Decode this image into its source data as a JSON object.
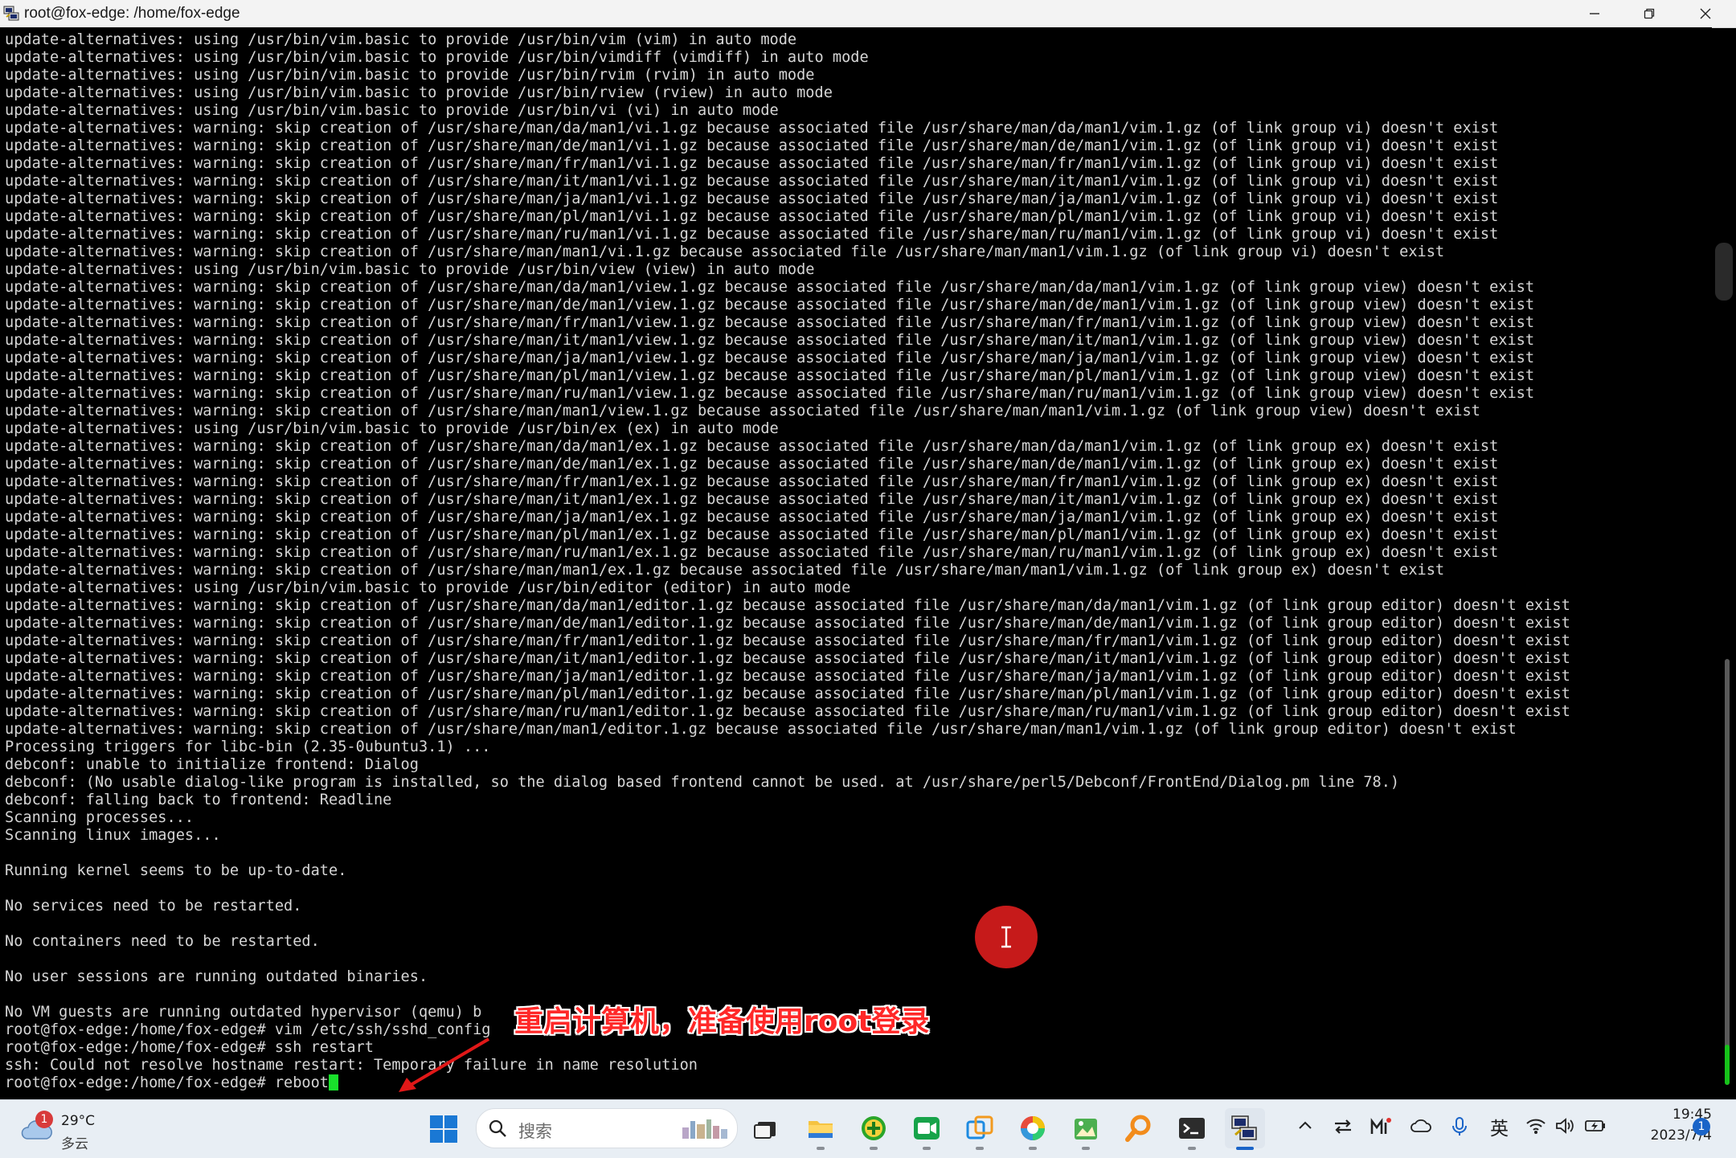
{
  "window": {
    "title": "root@fox-edge: /home/fox-edge"
  },
  "terminal": {
    "lines": [
      "update-alternatives: using /usr/bin/vim.basic to provide /usr/bin/vim (vim) in auto mode",
      "update-alternatives: using /usr/bin/vim.basic to provide /usr/bin/vimdiff (vimdiff) in auto mode",
      "update-alternatives: using /usr/bin/vim.basic to provide /usr/bin/rvim (rvim) in auto mode",
      "update-alternatives: using /usr/bin/vim.basic to provide /usr/bin/rview (rview) in auto mode",
      "update-alternatives: using /usr/bin/vim.basic to provide /usr/bin/vi (vi) in auto mode",
      "update-alternatives: warning: skip creation of /usr/share/man/da/man1/vi.1.gz because associated file /usr/share/man/da/man1/vim.1.gz (of link group vi) doesn't exist",
      "update-alternatives: warning: skip creation of /usr/share/man/de/man1/vi.1.gz because associated file /usr/share/man/de/man1/vim.1.gz (of link group vi) doesn't exist",
      "update-alternatives: warning: skip creation of /usr/share/man/fr/man1/vi.1.gz because associated file /usr/share/man/fr/man1/vim.1.gz (of link group vi) doesn't exist",
      "update-alternatives: warning: skip creation of /usr/share/man/it/man1/vi.1.gz because associated file /usr/share/man/it/man1/vim.1.gz (of link group vi) doesn't exist",
      "update-alternatives: warning: skip creation of /usr/share/man/ja/man1/vi.1.gz because associated file /usr/share/man/ja/man1/vim.1.gz (of link group vi) doesn't exist",
      "update-alternatives: warning: skip creation of /usr/share/man/pl/man1/vi.1.gz because associated file /usr/share/man/pl/man1/vim.1.gz (of link group vi) doesn't exist",
      "update-alternatives: warning: skip creation of /usr/share/man/ru/man1/vi.1.gz because associated file /usr/share/man/ru/man1/vim.1.gz (of link group vi) doesn't exist",
      "update-alternatives: warning: skip creation of /usr/share/man/man1/vi.1.gz because associated file /usr/share/man/man1/vim.1.gz (of link group vi) doesn't exist",
      "update-alternatives: using /usr/bin/vim.basic to provide /usr/bin/view (view) in auto mode",
      "update-alternatives: warning: skip creation of /usr/share/man/da/man1/view.1.gz because associated file /usr/share/man/da/man1/vim.1.gz (of link group view) doesn't exist",
      "update-alternatives: warning: skip creation of /usr/share/man/de/man1/view.1.gz because associated file /usr/share/man/de/man1/vim.1.gz (of link group view) doesn't exist",
      "update-alternatives: warning: skip creation of /usr/share/man/fr/man1/view.1.gz because associated file /usr/share/man/fr/man1/vim.1.gz (of link group view) doesn't exist",
      "update-alternatives: warning: skip creation of /usr/share/man/it/man1/view.1.gz because associated file /usr/share/man/it/man1/vim.1.gz (of link group view) doesn't exist",
      "update-alternatives: warning: skip creation of /usr/share/man/ja/man1/view.1.gz because associated file /usr/share/man/ja/man1/vim.1.gz (of link group view) doesn't exist",
      "update-alternatives: warning: skip creation of /usr/share/man/pl/man1/view.1.gz because associated file /usr/share/man/pl/man1/vim.1.gz (of link group view) doesn't exist",
      "update-alternatives: warning: skip creation of /usr/share/man/ru/man1/view.1.gz because associated file /usr/share/man/ru/man1/vim.1.gz (of link group view) doesn't exist",
      "update-alternatives: warning: skip creation of /usr/share/man/man1/view.1.gz because associated file /usr/share/man/man1/vim.1.gz (of link group view) doesn't exist",
      "update-alternatives: using /usr/bin/vim.basic to provide /usr/bin/ex (ex) in auto mode",
      "update-alternatives: warning: skip creation of /usr/share/man/da/man1/ex.1.gz because associated file /usr/share/man/da/man1/vim.1.gz (of link group ex) doesn't exist",
      "update-alternatives: warning: skip creation of /usr/share/man/de/man1/ex.1.gz because associated file /usr/share/man/de/man1/vim.1.gz (of link group ex) doesn't exist",
      "update-alternatives: warning: skip creation of /usr/share/man/fr/man1/ex.1.gz because associated file /usr/share/man/fr/man1/vim.1.gz (of link group ex) doesn't exist",
      "update-alternatives: warning: skip creation of /usr/share/man/it/man1/ex.1.gz because associated file /usr/share/man/it/man1/vim.1.gz (of link group ex) doesn't exist",
      "update-alternatives: warning: skip creation of /usr/share/man/ja/man1/ex.1.gz because associated file /usr/share/man/ja/man1/vim.1.gz (of link group ex) doesn't exist",
      "update-alternatives: warning: skip creation of /usr/share/man/pl/man1/ex.1.gz because associated file /usr/share/man/pl/man1/vim.1.gz (of link group ex) doesn't exist",
      "update-alternatives: warning: skip creation of /usr/share/man/ru/man1/ex.1.gz because associated file /usr/share/man/ru/man1/vim.1.gz (of link group ex) doesn't exist",
      "update-alternatives: warning: skip creation of /usr/share/man/man1/ex.1.gz because associated file /usr/share/man/man1/vim.1.gz (of link group ex) doesn't exist",
      "update-alternatives: using /usr/bin/vim.basic to provide /usr/bin/editor (editor) in auto mode",
      "update-alternatives: warning: skip creation of /usr/share/man/da/man1/editor.1.gz because associated file /usr/share/man/da/man1/vim.1.gz (of link group editor) doesn't exist",
      "update-alternatives: warning: skip creation of /usr/share/man/de/man1/editor.1.gz because associated file /usr/share/man/de/man1/vim.1.gz (of link group editor) doesn't exist",
      "update-alternatives: warning: skip creation of /usr/share/man/fr/man1/editor.1.gz because associated file /usr/share/man/fr/man1/vim.1.gz (of link group editor) doesn't exist",
      "update-alternatives: warning: skip creation of /usr/share/man/it/man1/editor.1.gz because associated file /usr/share/man/it/man1/vim.1.gz (of link group editor) doesn't exist",
      "update-alternatives: warning: skip creation of /usr/share/man/ja/man1/editor.1.gz because associated file /usr/share/man/ja/man1/vim.1.gz (of link group editor) doesn't exist",
      "update-alternatives: warning: skip creation of /usr/share/man/pl/man1/editor.1.gz because associated file /usr/share/man/pl/man1/vim.1.gz (of link group editor) doesn't exist",
      "update-alternatives: warning: skip creation of /usr/share/man/ru/man1/editor.1.gz because associated file /usr/share/man/ru/man1/vim.1.gz (of link group editor) doesn't exist",
      "update-alternatives: warning: skip creation of /usr/share/man/man1/editor.1.gz because associated file /usr/share/man/man1/vim.1.gz (of link group editor) doesn't exist",
      "Processing triggers for libc-bin (2.35-0ubuntu3.1) ...",
      "debconf: unable to initialize frontend: Dialog",
      "debconf: (No usable dialog-like program is installed, so the dialog based frontend cannot be used. at /usr/share/perl5/Debconf/FrontEnd/Dialog.pm line 78.)",
      "debconf: falling back to frontend: Readline",
      "Scanning processes...",
      "Scanning linux images...",
      "",
      "Running kernel seems to be up-to-date.",
      "",
      "No services need to be restarted.",
      "",
      "No containers need to be restarted.",
      "",
      "No user sessions are running outdated binaries.",
      "",
      "No VM guests are running outdated hypervisor (qemu) b",
      "root@fox-edge:/home/fox-edge# vim /etc/ssh/sshd_config",
      "root@fox-edge:/home/fox-edge# ssh restart",
      "ssh: Could not resolve hostname restart: Temporary failure in name resolution"
    ],
    "prompt": "root@fox-edge:/home/fox-edge# reboot"
  },
  "annotation": {
    "text": "重启计算机，准备使用root登录",
    "color": "#ff2828"
  },
  "taskbar": {
    "weather": {
      "badge": "1",
      "temp": "29°C",
      "desc": "多云"
    },
    "search_placeholder": "搜索",
    "ime": "英",
    "time": "19:45",
    "date": "2023/7/4",
    "notification_count": "1"
  }
}
